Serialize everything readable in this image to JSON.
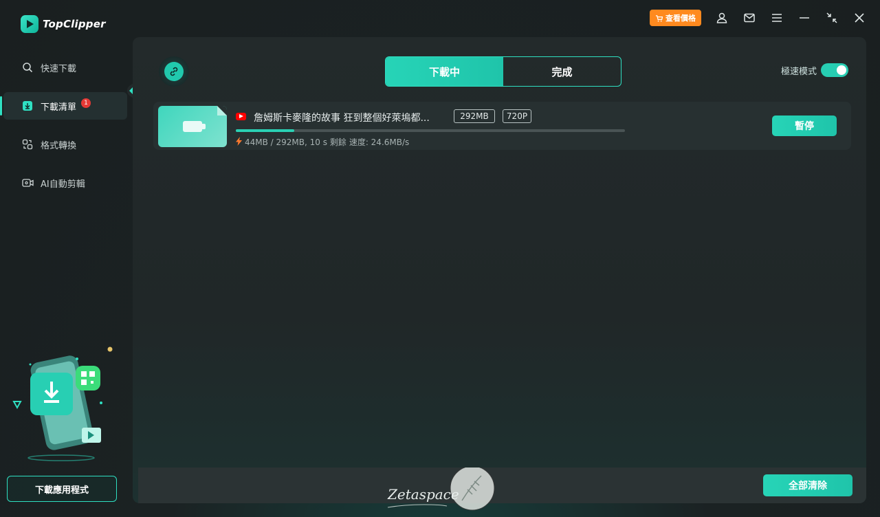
{
  "app": {
    "name": "TopClipper"
  },
  "topbar": {
    "price_label": "查看價格",
    "icons": [
      "cart-icon",
      "user-icon",
      "mail-icon",
      "menu-icon",
      "minimize-icon",
      "restore-icon",
      "close-icon"
    ]
  },
  "sidebar": {
    "items": [
      {
        "label": "快速下載",
        "icon": "search-icon",
        "active": false
      },
      {
        "label": "下載清單",
        "icon": "download-icon",
        "active": true,
        "badge": "1"
      },
      {
        "label": "格式轉換",
        "icon": "convert-icon",
        "active": false
      },
      {
        "label": "AI自動剪輯",
        "icon": "ai-cut-icon",
        "active": false
      }
    ],
    "download_app_label": "下載應用程式"
  },
  "main": {
    "tabs": [
      {
        "label": "下載中",
        "active": true
      },
      {
        "label": "完成",
        "active": false
      }
    ],
    "speed_mode": {
      "label": "極速模式",
      "enabled": true
    },
    "downloads": [
      {
        "source_icon": "youtube-icon",
        "title": "詹姆斯卡麥隆的故事 狂到整個好萊塢都...",
        "size_tag": "292MB",
        "resolution_tag": "720P",
        "progress": 0.15,
        "stats": "44MB / 292MB, 10 s 剩餘",
        "speed": "速度: 24.6MB/s",
        "action_label": "暫停"
      }
    ],
    "clear_all_label": "全部清除"
  },
  "watermark": {
    "text": "Zetaspace"
  },
  "colors": {
    "accent": "#27d4b7",
    "price": "#ff8a1f",
    "badge": "#e53935"
  }
}
